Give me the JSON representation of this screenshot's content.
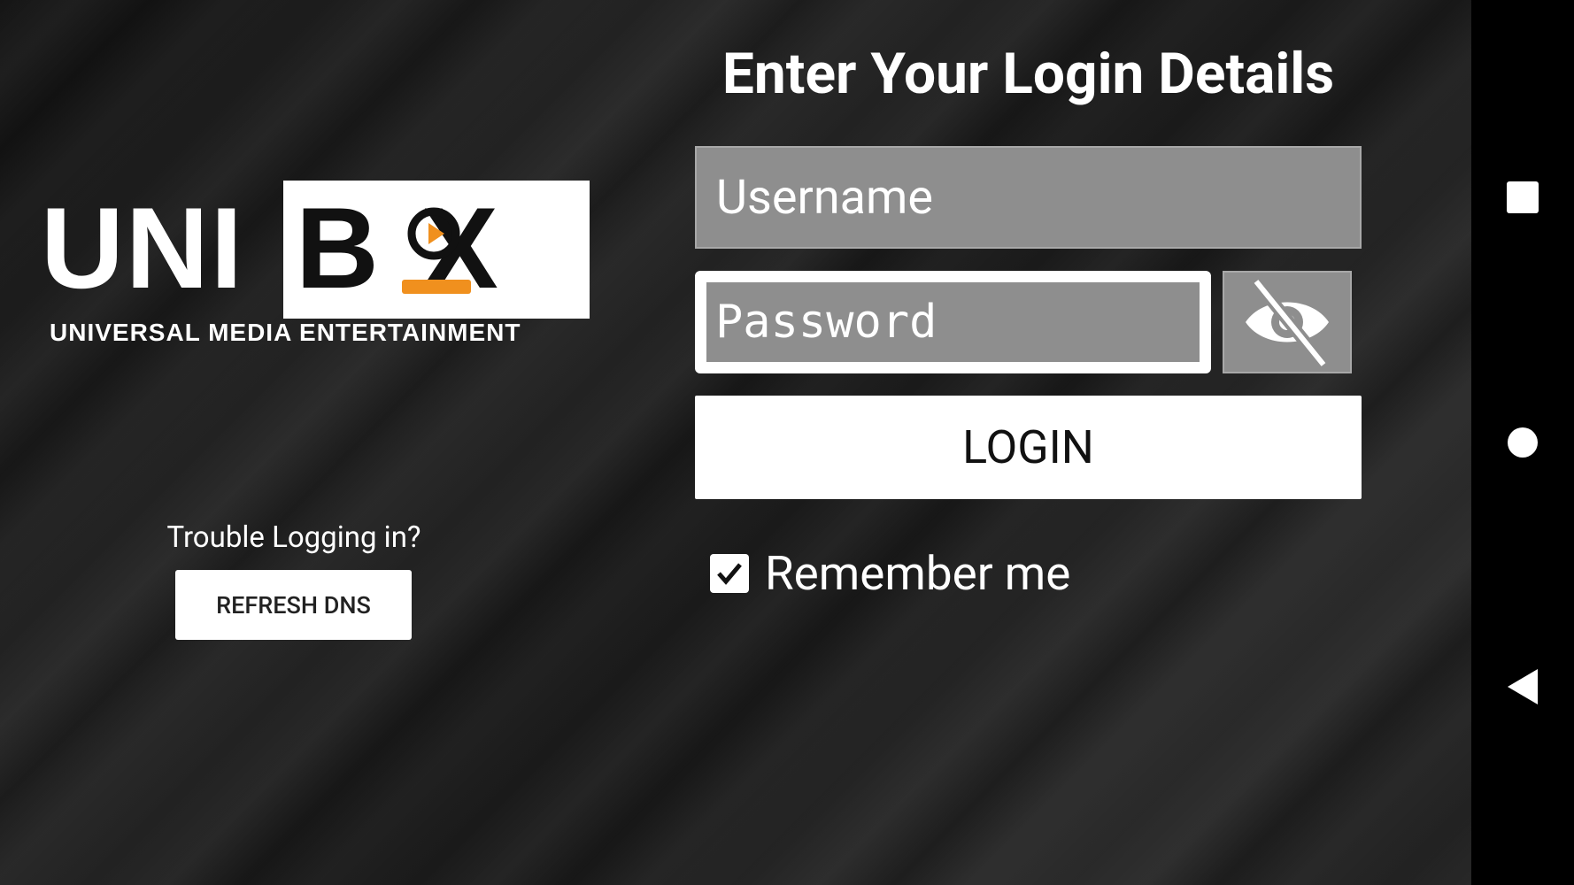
{
  "logo": {
    "left_text": "UNI",
    "box_text": "B X",
    "tagline": "UNIVERSAL MEDIA ENTERTAINMENT",
    "accent_color": "#f0901e"
  },
  "help": {
    "text": "Trouble Logging in?",
    "refresh_button": "REFRESH DNS"
  },
  "form": {
    "title": "Enter Your Login Details",
    "username_placeholder": "Username",
    "password_placeholder": "Password",
    "toggle_icon": "eye-off-icon",
    "login_button": "LOGIN",
    "remember_label": "Remember me",
    "remember_checked": true
  },
  "navbar": {
    "items": [
      "recents-icon",
      "home-icon",
      "back-icon"
    ]
  }
}
